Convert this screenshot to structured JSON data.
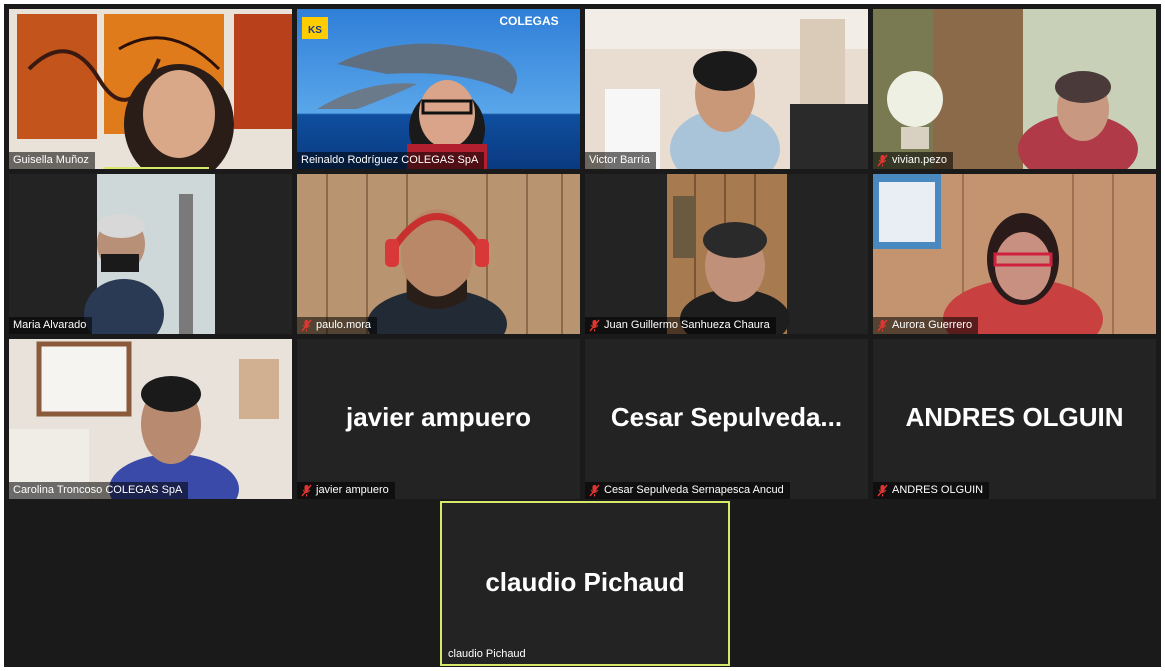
{
  "participants": [
    {
      "name": "Guisella Muñoz",
      "muted": false,
      "video": true
    },
    {
      "name": "Reinaldo Rodríguez  COLEGAS SpA",
      "muted": false,
      "video": true,
      "banner_text": "COLEGAS"
    },
    {
      "name": "Victor Barría",
      "muted": false,
      "video": true
    },
    {
      "name": "vivian.pezo",
      "muted": true,
      "video": true
    },
    {
      "name": "Maria Alvarado",
      "muted": false,
      "video": true
    },
    {
      "name": "paulo.mora",
      "muted": true,
      "video": true
    },
    {
      "name": "Juan Guillermo Sanhueza Chaura",
      "muted": true,
      "video": true
    },
    {
      "name": "Aurora Guerrero",
      "muted": true,
      "video": true
    },
    {
      "name": "Carolina Troncoso COLEGAS SpA",
      "muted": false,
      "video": true
    },
    {
      "name": "javier ampuero",
      "muted": true,
      "video": false,
      "display_name": "javier ampuero"
    },
    {
      "name": "Cesar Sepulveda Sernapesca Ancud",
      "muted": true,
      "video": false,
      "display_name": "Cesar  Sepulveda..."
    },
    {
      "name": "ANDRES OLGUIN",
      "muted": true,
      "video": false,
      "display_name": "ANDRES OLGUIN"
    },
    {
      "name": "claudio Pichaud",
      "muted": false,
      "video": false,
      "display_name": "claudio Pichaud",
      "active_speaker": true
    }
  ],
  "colors": {
    "background": "#1a1a1a",
    "tile": "#232323",
    "active_speaker_border": "#d8e86a",
    "muted_icon": "#e0362f"
  }
}
